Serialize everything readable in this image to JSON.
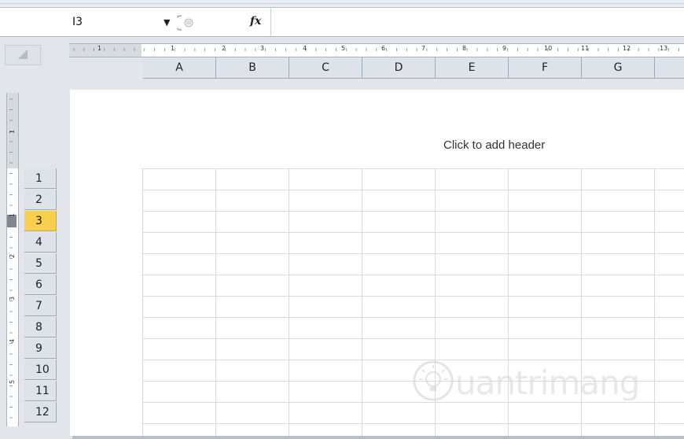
{
  "formula_bar": {
    "name_box": "I3",
    "fx_label": "fx",
    "formula_value": ""
  },
  "ruler": {
    "horizontal_numbers": [
      "1",
      "1",
      "2",
      "3",
      "4",
      "5",
      "6",
      "7",
      "8",
      "9",
      "10",
      "11",
      "12",
      "13"
    ],
    "vertical_numbers": [
      "1",
      "1",
      "2",
      "3",
      "4",
      "5"
    ]
  },
  "columns": [
    "A",
    "B",
    "C",
    "D",
    "E",
    "F",
    "G"
  ],
  "rows": [
    {
      "label": "1",
      "active": false
    },
    {
      "label": "2",
      "active": false
    },
    {
      "label": "3",
      "active": true
    },
    {
      "label": "4",
      "active": false
    },
    {
      "label": "5",
      "active": false
    },
    {
      "label": "6",
      "active": false
    },
    {
      "label": "7",
      "active": false
    },
    {
      "label": "8",
      "active": false
    },
    {
      "label": "9",
      "active": false
    },
    {
      "label": "10",
      "active": false
    },
    {
      "label": "11",
      "active": false
    },
    {
      "label": "12",
      "active": false
    }
  ],
  "page": {
    "header_placeholder": "Click to add header"
  },
  "watermark": {
    "text": "uantrimang"
  },
  "colors": {
    "selected_row": "#f9d04d",
    "header_bg": "#dee3ea",
    "grid_line": "#d9d9d9"
  }
}
